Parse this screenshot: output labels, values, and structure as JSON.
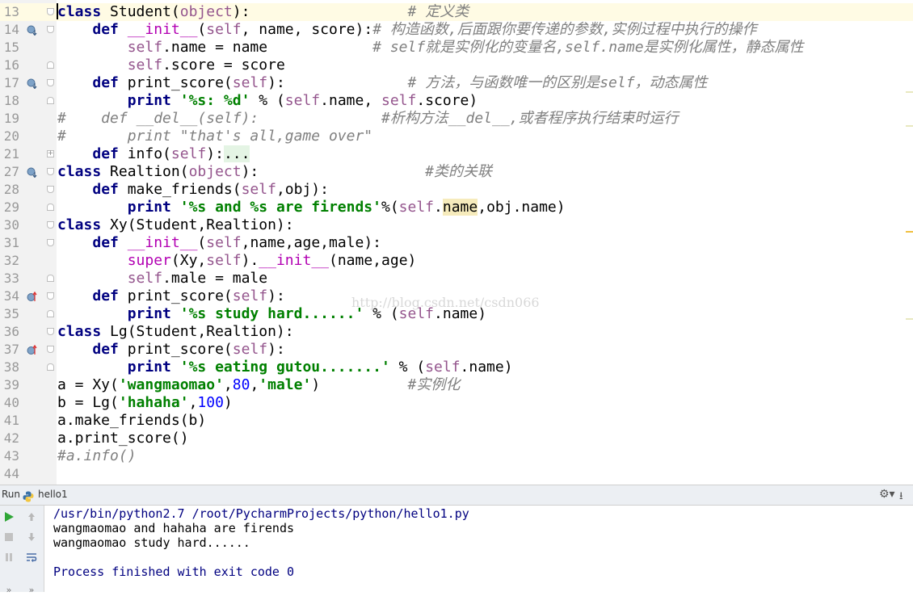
{
  "editor": {
    "current_line": "13",
    "lines": [
      {
        "n": "13",
        "code": [
          {
            "t": "class",
            "c": "kw"
          },
          {
            "t": " Student("
          },
          {
            "t": "object",
            "c": "sf"
          },
          {
            "t": "):"
          },
          {
            "t": "                  # 定义类",
            "c": "cm"
          }
        ]
      },
      {
        "n": "14",
        "code": [
          {
            "t": "    "
          },
          {
            "t": "def",
            "c": "kw"
          },
          {
            "t": " "
          },
          {
            "t": "__init__",
            "c": "mg"
          },
          {
            "t": "("
          },
          {
            "t": "self",
            "c": "sf"
          },
          {
            "t": ", name, score):"
          },
          {
            "t": "# 构造函数,后面跟你要传递的参数,实例过程中执行的操作",
            "c": "cm"
          }
        ]
      },
      {
        "n": "15",
        "code": [
          {
            "t": "        "
          },
          {
            "t": "self",
            "c": "sf"
          },
          {
            "t": ".name = name"
          },
          {
            "t": "            # self就是实例化的变量名,self.name是实例化属性，静态属性",
            "c": "cm"
          }
        ]
      },
      {
        "n": "16",
        "code": [
          {
            "t": "        "
          },
          {
            "t": "self",
            "c": "sf"
          },
          {
            "t": ".score = score"
          }
        ]
      },
      {
        "n": "17",
        "code": [
          {
            "t": "    "
          },
          {
            "t": "def",
            "c": "kw"
          },
          {
            "t": " print_score("
          },
          {
            "t": "self",
            "c": "sf"
          },
          {
            "t": "):"
          },
          {
            "t": "              # 方法，与函数唯一的区别是self，动态属性",
            "c": "cm"
          }
        ]
      },
      {
        "n": "18",
        "code": [
          {
            "t": "        "
          },
          {
            "t": "print",
            "c": "kw"
          },
          {
            "t": " "
          },
          {
            "t": "'%s: %d'",
            "c": "st"
          },
          {
            "t": " % ("
          },
          {
            "t": "self",
            "c": "sf"
          },
          {
            "t": ".name, "
          },
          {
            "t": "self",
            "c": "sf"
          },
          {
            "t": ".score)"
          }
        ]
      },
      {
        "n": "19",
        "code": [
          {
            "t": "#    def __del__(self):              #析构方法__del__,或者程序执行结束时运行",
            "c": "cm"
          }
        ]
      },
      {
        "n": "20",
        "code": [
          {
            "t": "#       print \"that's all,game over\"",
            "c": "cm"
          }
        ]
      },
      {
        "n": "21",
        "code": [
          {
            "t": "    "
          },
          {
            "t": "def",
            "c": "kw"
          },
          {
            "t": " info("
          },
          {
            "t": "self",
            "c": "sf"
          },
          {
            "t": "):"
          },
          {
            "t": "...",
            "c": "ell"
          }
        ]
      },
      {
        "n": "27",
        "code": [
          {
            "t": "class",
            "c": "kw"
          },
          {
            "t": " Realtion("
          },
          {
            "t": "object",
            "c": "sf"
          },
          {
            "t": "):"
          },
          {
            "t": "                   #类的关联",
            "c": "cm"
          }
        ]
      },
      {
        "n": "28",
        "code": [
          {
            "t": "    "
          },
          {
            "t": "def",
            "c": "kw"
          },
          {
            "t": " make_friends("
          },
          {
            "t": "self",
            "c": "sf"
          },
          {
            "t": ",obj):"
          }
        ]
      },
      {
        "n": "29",
        "code": [
          {
            "t": "        "
          },
          {
            "t": "print",
            "c": "kw"
          },
          {
            "t": " "
          },
          {
            "t": "'%s and %s are firends'",
            "c": "st"
          },
          {
            "t": "%("
          },
          {
            "t": "self",
            "c": "sf"
          },
          {
            "t": "."
          },
          {
            "t": "name",
            "c": "hl"
          },
          {
            "t": ",obj.name)"
          }
        ]
      },
      {
        "n": "30",
        "code": [
          {
            "t": "class",
            "c": "kw"
          },
          {
            "t": " Xy(Student,Realtion):"
          }
        ]
      },
      {
        "n": "31",
        "code": [
          {
            "t": "    "
          },
          {
            "t": "def",
            "c": "kw"
          },
          {
            "t": " "
          },
          {
            "t": "__init__",
            "c": "mg"
          },
          {
            "t": "("
          },
          {
            "t": "self",
            "c": "sf"
          },
          {
            "t": ",name,age,male):"
          }
        ]
      },
      {
        "n": "32",
        "code": [
          {
            "t": "        "
          },
          {
            "t": "super",
            "c": "mg"
          },
          {
            "t": "(Xy,"
          },
          {
            "t": "self",
            "c": "sf"
          },
          {
            "t": ")."
          },
          {
            "t": "__init__",
            "c": "mg"
          },
          {
            "t": "(name,age)"
          }
        ]
      },
      {
        "n": "33",
        "code": [
          {
            "t": "        "
          },
          {
            "t": "self",
            "c": "sf"
          },
          {
            "t": ".male = male"
          }
        ]
      },
      {
        "n": "34",
        "code": [
          {
            "t": "    "
          },
          {
            "t": "def",
            "c": "kw"
          },
          {
            "t": " print_score("
          },
          {
            "t": "self",
            "c": "sf"
          },
          {
            "t": "):"
          }
        ]
      },
      {
        "n": "35",
        "code": [
          {
            "t": "        "
          },
          {
            "t": "print",
            "c": "kw"
          },
          {
            "t": " "
          },
          {
            "t": "'%s study hard......'",
            "c": "st"
          },
          {
            "t": " % ("
          },
          {
            "t": "self",
            "c": "sf"
          },
          {
            "t": ".name)"
          }
        ]
      },
      {
        "n": "36",
        "code": [
          {
            "t": "class",
            "c": "kw"
          },
          {
            "t": " Lg(Student,Realtion):"
          }
        ]
      },
      {
        "n": "37",
        "code": [
          {
            "t": "    "
          },
          {
            "t": "def",
            "c": "kw"
          },
          {
            "t": " print_score("
          },
          {
            "t": "self",
            "c": "sf"
          },
          {
            "t": "):"
          }
        ]
      },
      {
        "n": "38",
        "code": [
          {
            "t": "        "
          },
          {
            "t": "print",
            "c": "kw"
          },
          {
            "t": " "
          },
          {
            "t": "'%s eating gutou.......'",
            "c": "st"
          },
          {
            "t": " % ("
          },
          {
            "t": "self",
            "c": "sf"
          },
          {
            "t": ".name)"
          }
        ]
      },
      {
        "n": "39",
        "code": [
          {
            "t": "a = Xy("
          },
          {
            "t": "'wangmaomao'",
            "c": "st"
          },
          {
            "t": ","
          },
          {
            "t": "80",
            "c": "nm"
          },
          {
            "t": ","
          },
          {
            "t": "'male'",
            "c": "st"
          },
          {
            "t": ")"
          },
          {
            "t": "          #实例化",
            "c": "cm"
          }
        ]
      },
      {
        "n": "40",
        "code": [
          {
            "t": "b = Lg("
          },
          {
            "t": "'hahaha'",
            "c": "st"
          },
          {
            "t": ","
          },
          {
            "t": "100",
            "c": "nm"
          },
          {
            "t": ")"
          }
        ]
      },
      {
        "n": "41",
        "code": [
          {
            "t": "a.make_friends(b)"
          }
        ]
      },
      {
        "n": "42",
        "code": [
          {
            "t": "a.print_score()"
          }
        ]
      },
      {
        "n": "43",
        "code": [
          {
            "t": "#a.info()",
            "c": "cm"
          }
        ]
      },
      {
        "n": "44",
        "code": []
      }
    ],
    "markers": {
      "14": "override",
      "17": "override",
      "27": "override",
      "34": "implements",
      "37": "implements"
    },
    "watermark": "http://blog.csdn.net/csdn066"
  },
  "run": {
    "label": "Run",
    "config": "hello1",
    "console": {
      "command": "/usr/bin/python2.7 /root/PycharmProjects/python/hello1.py",
      "output": [
        "wangmaomao and hahaha are firends",
        "wangmaomao study hard......",
        "",
        "Process finished with exit code 0"
      ]
    }
  },
  "colors": {
    "keyword": "#000080",
    "self": "#94558d",
    "string": "#008000",
    "number": "#0000ff",
    "comment": "#808080",
    "magic": "#b200b2",
    "run_green": "#2fa637"
  },
  "icons": {
    "run": "run-icon",
    "up": "arrow-up-icon",
    "down": "arrow-down-icon",
    "stop": "stop-icon",
    "pause": "pause-icon",
    "wrap": "soft-wrap-icon",
    "settings": "gear-icon",
    "hide": "hide-icon",
    "more": "more-icon"
  }
}
